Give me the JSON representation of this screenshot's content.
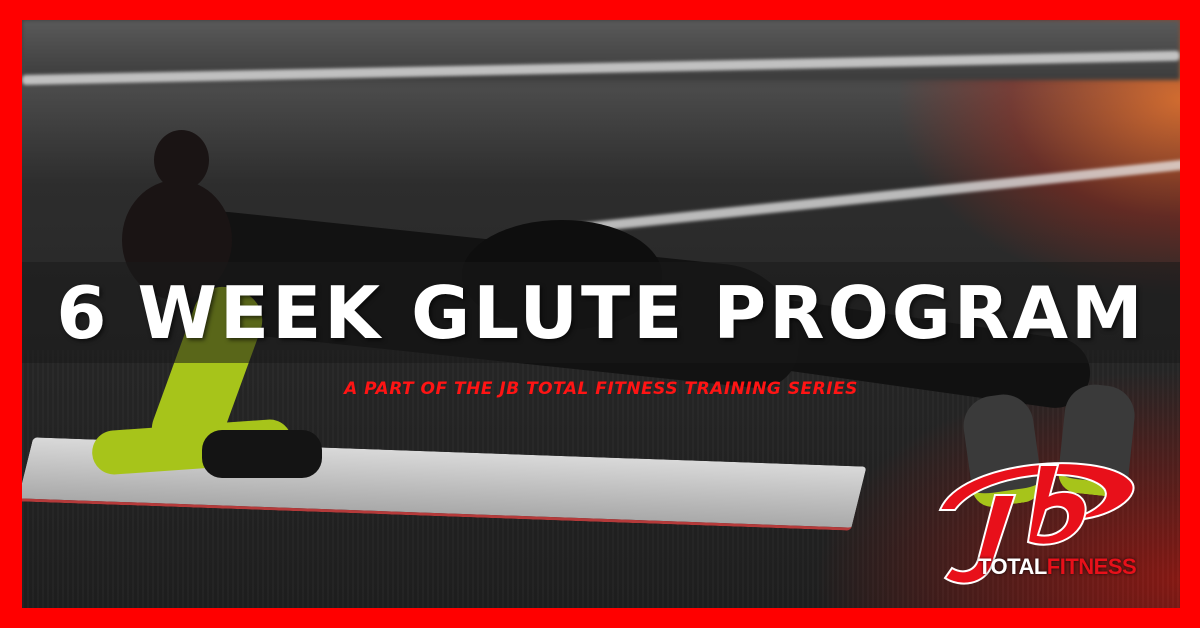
{
  "banner": {
    "title": "6 WEEK GLUTE PROGRAM",
    "subtitle": "A PART OF THE JB TOTAL FITNESS TRAINING SERIES"
  },
  "logo": {
    "mark_icon": "jb-swoosh-logo-icon",
    "word_total": "TOTAL",
    "word_fitness": "FITNESS"
  },
  "colors": {
    "frame": "#ff0000",
    "accent_red": "#e8101a",
    "title_text": "#ffffff",
    "band": "#191919"
  }
}
